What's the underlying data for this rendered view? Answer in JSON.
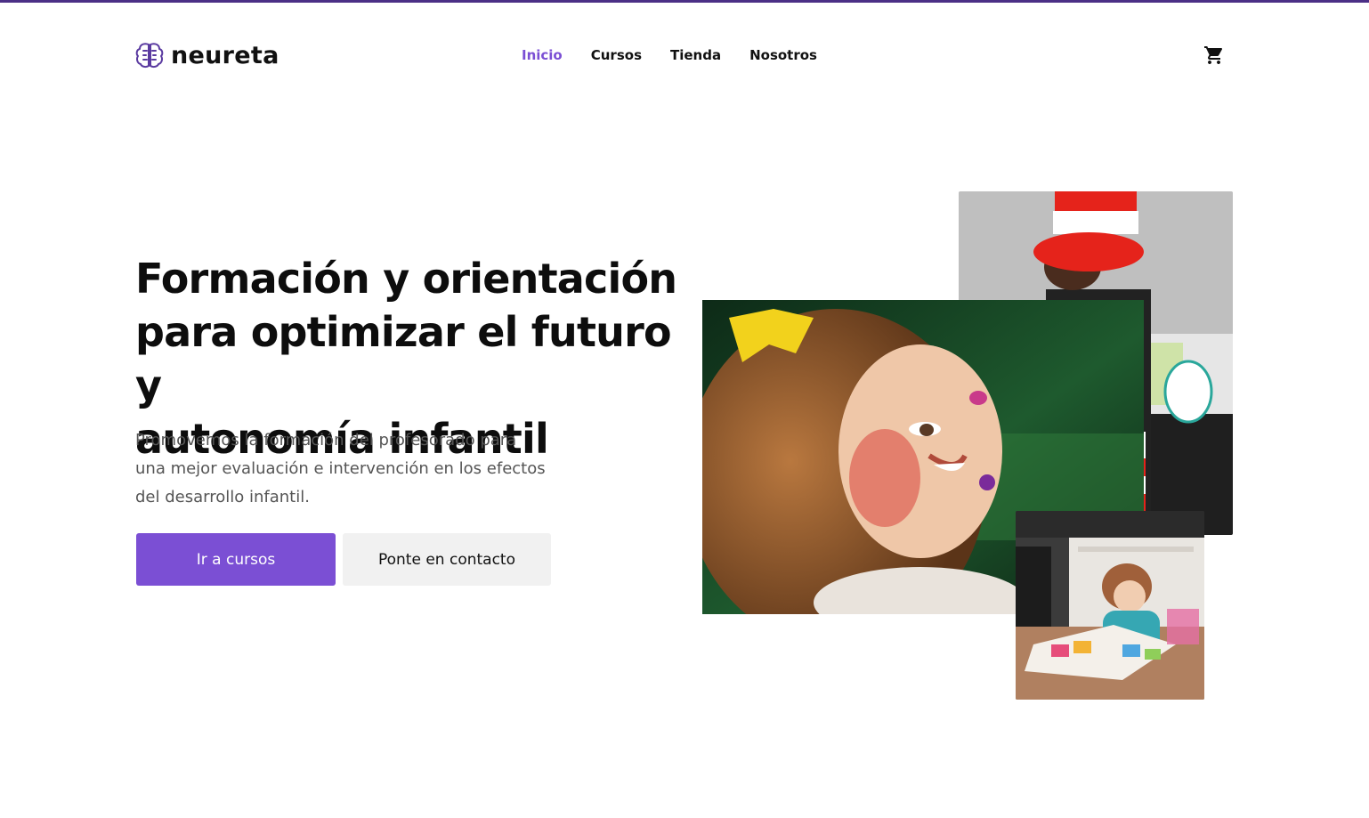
{
  "brand": {
    "name": "neureta",
    "logo_icon": "brain-icon"
  },
  "nav": {
    "items": [
      {
        "label": "Inicio",
        "active": true
      },
      {
        "label": "Cursos",
        "active": false
      },
      {
        "label": "Tienda",
        "active": false
      },
      {
        "label": "Nosotros",
        "active": false
      }
    ],
    "cart_icon": "shopping-cart-icon"
  },
  "hero": {
    "title_lines": [
      "Formación y orientación",
      "para optimizar el futuro y",
      "autonomía infantil"
    ],
    "subtitle_lines": [
      "Promovemos la formación del profesorado para",
      "una mejor evaluación e intervención en los efectos",
      "del desarrollo infantil."
    ],
    "primary_button": "Ir a cursos",
    "secondary_button": "Ponte en contacto"
  },
  "colors": {
    "accent": "#7b4fd4",
    "top_bar": "#4b2f86",
    "secondary_button_bg": "#f1f1f1",
    "subtitle_text": "#555555"
  }
}
